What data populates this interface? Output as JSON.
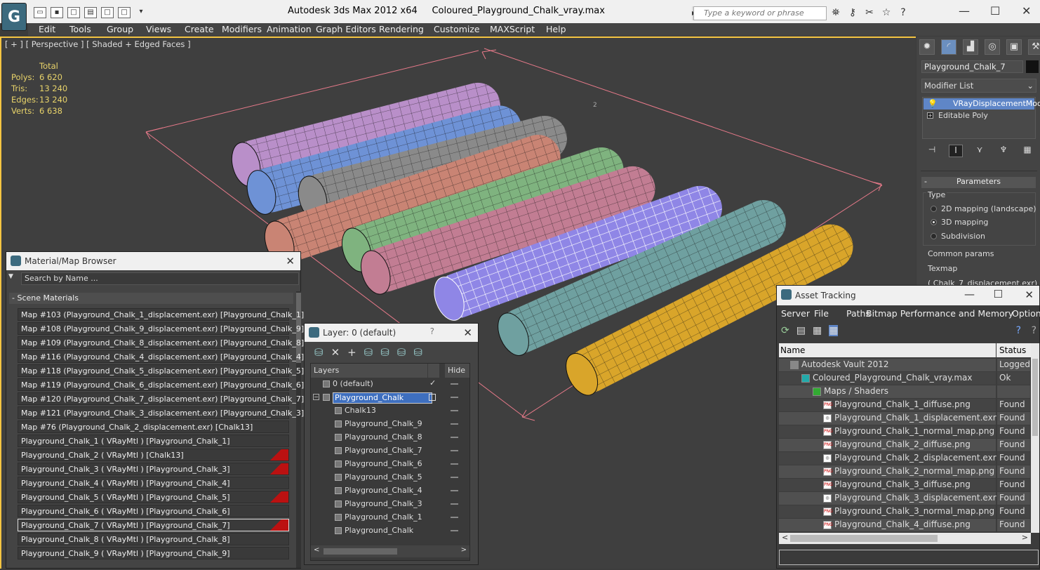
{
  "app": {
    "title": "Autodesk 3ds Max  2012 x64",
    "file": "Coloured_Playground_Chalk_vray.max",
    "search_placeholder": "Type a keyword or phrase"
  },
  "menu": [
    "Edit",
    "Tools",
    "Group",
    "Views",
    "Create",
    "Modifiers",
    "Animation",
    "Graph Editors",
    "Rendering",
    "Customize",
    "MAXScript",
    "Help"
  ],
  "viewport": {
    "label": "[ + ] [ Perspective ] [ Shaded + Edged Faces ]",
    "stats_header": "Total",
    "stats": [
      {
        "k": "Polys:",
        "v": "6 620"
      },
      {
        "k": "Tris:",
        "v": "13 240"
      },
      {
        "k": "Edges:",
        "v": "13 240"
      },
      {
        "k": "Verts:",
        "v": "6 638"
      }
    ],
    "marker": "2"
  },
  "command_panel": {
    "object_name": "Playground_Chalk_7",
    "modifier_list": "Modifier List",
    "stack": [
      "VRayDisplacementMod",
      "Editable Poly"
    ],
    "rollout": "Parameters",
    "type_label": "Type",
    "options": [
      "2D mapping (landscape)",
      "3D mapping",
      "Subdivision"
    ],
    "selected_option": "3D mapping",
    "common_label": "Common params",
    "texmap_label": "Texmap",
    "texmap_value": "( Chalk_7_displacement.exr)"
  },
  "material_browser": {
    "title": "Material/Map Browser",
    "search_placeholder": "Search by Name ...",
    "group": "Scene Materials",
    "items": [
      {
        "text": "Map #103 (Playground_Chalk_1_displacement.exr)  [Playground_Chalk_1]",
        "tag": false
      },
      {
        "text": "Map #108 (Playground_Chalk_9_displacement.exr)  [Playground_Chalk_9]",
        "tag": false
      },
      {
        "text": "Map #109 (Playground_Chalk_8_displacement.exr)  [Playground_Chalk_8]",
        "tag": false
      },
      {
        "text": "Map #116 (Playground_Chalk_4_displacement.exr)  [Playground_Chalk_4]",
        "tag": false
      },
      {
        "text": "Map #118 (Playground_Chalk_5_displacement.exr)  [Playground_Chalk_5]",
        "tag": false
      },
      {
        "text": "Map #119 (Playground_Chalk_6_displacement.exr)  [Playground_Chalk_6]",
        "tag": false
      },
      {
        "text": "Map #120 (Playground_Chalk_7_displacement.exr)  [Playground_Chalk_7]",
        "tag": false
      },
      {
        "text": "Map #121 (Playground_Chalk_3_displacement.exr)  [Playground_Chalk_3]",
        "tag": false
      },
      {
        "text": "Map #76 (Playground_Chalk_2_displacement.exr)  [Chalk13]",
        "tag": false
      },
      {
        "text": "Playground_Chalk_1  ( VRayMtl )  [Playground_Chalk_1]",
        "tag": false
      },
      {
        "text": "Playground_Chalk_2  ( VRayMtl )  [Chalk13]",
        "tag": true
      },
      {
        "text": "Playground_Chalk_3  ( VRayMtl )  [Playground_Chalk_3]",
        "tag": true
      },
      {
        "text": "Playground_Chalk_4  ( VRayMtl )  [Playground_Chalk_4]",
        "tag": false
      },
      {
        "text": "Playground_Chalk_5  ( VRayMtl )  [Playground_Chalk_5]",
        "tag": true
      },
      {
        "text": "Playground_Chalk_6  ( VRayMtl )  [Playground_Chalk_6]",
        "tag": false
      },
      {
        "text": "Playground_Chalk_7  ( VRayMtl )  [Playground_Chalk_7]",
        "tag": true
      },
      {
        "text": "Playground_Chalk_8  ( VRayMtl )  [Playground_Chalk_8]",
        "tag": false
      },
      {
        "text": "Playground_Chalk_9  ( VRayMtl )  [Playground_Chalk_9]",
        "tag": false
      }
    ]
  },
  "layer": {
    "title": "Layer: 0 (default)",
    "help": "?",
    "col_layers": "Layers",
    "col_hide": "Hide",
    "rows": [
      "0 (default)",
      "Playground_Chalk",
      "Chalk13",
      "Playground_Chalk_9",
      "Playground_Chalk_8",
      "Playground_Chalk_7",
      "Playground_Chalk_6",
      "Playground_Chalk_5",
      "Playground_Chalk_4",
      "Playground_Chalk_3",
      "Playground_Chalk_1",
      "Playground_Chalk"
    ]
  },
  "asset": {
    "title": "Asset Tracking",
    "menu": [
      "Server",
      "File",
      "Paths",
      "Bitmap Performance and Memory",
      "Options"
    ],
    "col_name": "Name",
    "col_status": "Status",
    "rows": [
      {
        "name": "Autodesk Vault 2012",
        "status": "Logged"
      },
      {
        "name": "Coloured_Playground_Chalk_vray.max",
        "status": "Ok"
      },
      {
        "name": "Maps / Shaders",
        "status": ""
      },
      {
        "name": "Playground_Chalk_1_diffuse.png",
        "status": "Found"
      },
      {
        "name": "Playground_Chalk_1_displacement.exr",
        "status": "Found"
      },
      {
        "name": "Playground_Chalk_1_normal_map.png",
        "status": "Found"
      },
      {
        "name": "Playground_Chalk_2_diffuse.png",
        "status": "Found"
      },
      {
        "name": "Playground_Chalk_2_displacement.exr",
        "status": "Found"
      },
      {
        "name": "Playground_Chalk_2_normal_map.png",
        "status": "Found"
      },
      {
        "name": "Playground_Chalk_3_diffuse.png",
        "status": "Found"
      },
      {
        "name": "Playground_Chalk_3_displacement.exr",
        "status": "Found"
      },
      {
        "name": "Playground_Chalk_3_normal_map.png",
        "status": "Found"
      },
      {
        "name": "Playground_Chalk_4_diffuse.png",
        "status": "Found"
      }
    ]
  },
  "chalks": [
    {
      "name": "Playground_Chalk_1",
      "color": "#b98fc9"
    },
    {
      "name": "Playground_Chalk_2",
      "color": "#6e92d6"
    },
    {
      "name": "Playground_Chalk_3",
      "color": "#8a8a8a"
    },
    {
      "name": "Playground_Chalk_4",
      "color": "#c98474"
    },
    {
      "name": "Playground_Chalk_5",
      "color": "#7fb37f"
    },
    {
      "name": "Playground_Chalk_6",
      "color": "#c27d93"
    },
    {
      "name": "Playground_Chalk_7",
      "color": "#8f86e6"
    },
    {
      "name": "Playground_Chalk_8",
      "color": "#6fa0a0"
    },
    {
      "name": "Playground_Chalk_9",
      "color": "#d9a52a"
    }
  ]
}
